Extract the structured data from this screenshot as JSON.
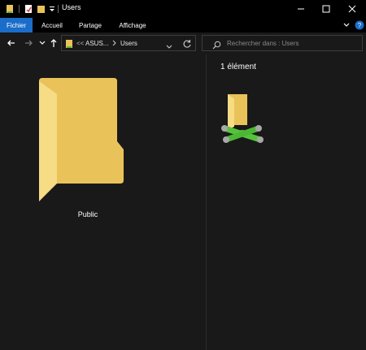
{
  "window": {
    "title": "Users",
    "controls": [
      "minimize",
      "maximize",
      "close"
    ]
  },
  "ribbon": {
    "tabs": [
      {
        "label": "Fichier",
        "active": true
      },
      {
        "label": "Accueil",
        "active": false
      },
      {
        "label": "Partage",
        "active": false
      },
      {
        "label": "Affichage",
        "active": false
      }
    ],
    "accent_color": "#1a6dc9"
  },
  "address": {
    "overflow": "<<",
    "segments": [
      "ASUS...",
      "Users"
    ]
  },
  "search": {
    "placeholder": "Rechercher dans : Users"
  },
  "files": [
    {
      "name": "Public",
      "icon": "folder-icon"
    }
  ],
  "preview": {
    "count_text": "1 élément",
    "icon": "network-folder-icon"
  },
  "colors": {
    "background": "#191919",
    "titlebar": "#000000",
    "folder": "#f3cf66"
  }
}
